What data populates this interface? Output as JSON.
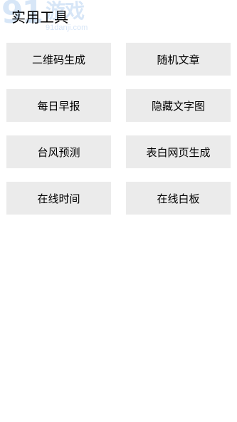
{
  "watermark": {
    "big": "91",
    "game": "游戏",
    "domain": "91danji.com"
  },
  "page": {
    "title": "实用工具"
  },
  "tools": [
    {
      "label": "二维码生成"
    },
    {
      "label": "随机文章"
    },
    {
      "label": "每日早报"
    },
    {
      "label": "隐藏文字图"
    },
    {
      "label": "台风预测"
    },
    {
      "label": "表白网页生成"
    },
    {
      "label": "在线时间"
    },
    {
      "label": "在线白板"
    }
  ]
}
